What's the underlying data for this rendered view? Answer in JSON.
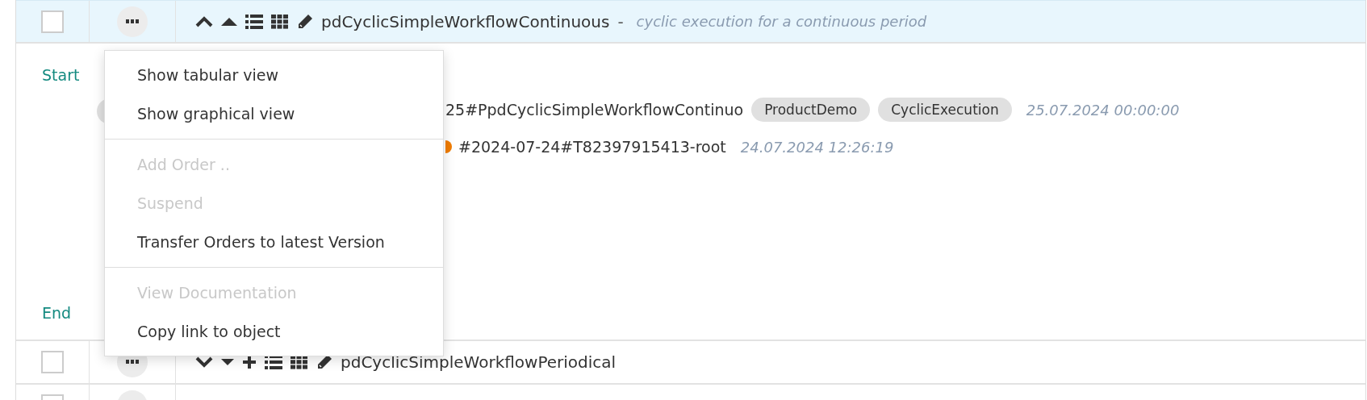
{
  "rows": [
    {
      "selected": true,
      "checked": false,
      "expanded": true,
      "name": "pdCyclicSimpleWorkflowContinuous",
      "separator": "-",
      "description": "cyclic execution for a continuous period",
      "detail": {
        "start_label": "Start",
        "end_label": "End",
        "lines": [
          {
            "text": "25#PpdCyclicSimpleWorkflowContinuo",
            "tags": [
              "ProductDemo",
              "CyclicExecution"
            ],
            "time": "25.07.2024 00:00:00"
          },
          {
            "color": "#f07c00",
            "text": "#2024-07-24#T82397915413-root",
            "time": "24.07.2024 12:26:19"
          }
        ]
      }
    },
    {
      "selected": false,
      "checked": false,
      "expanded": false,
      "name": "pdCyclicSimpleWorkflowPeriodical"
    },
    {
      "selected": false,
      "checked": false
    }
  ],
  "context_menu": {
    "groups": [
      [
        {
          "label": "Show tabular view",
          "disabled": false
        },
        {
          "label": "Show graphical view",
          "disabled": false
        }
      ],
      [
        {
          "label": "Add Order ..",
          "disabled": true
        },
        {
          "label": "Suspend",
          "disabled": true
        },
        {
          "label": "Transfer Orders to latest Version",
          "disabled": false
        }
      ],
      [
        {
          "label": "View Documentation",
          "disabled": true
        },
        {
          "label": "Copy link to object",
          "disabled": false
        }
      ]
    ]
  }
}
